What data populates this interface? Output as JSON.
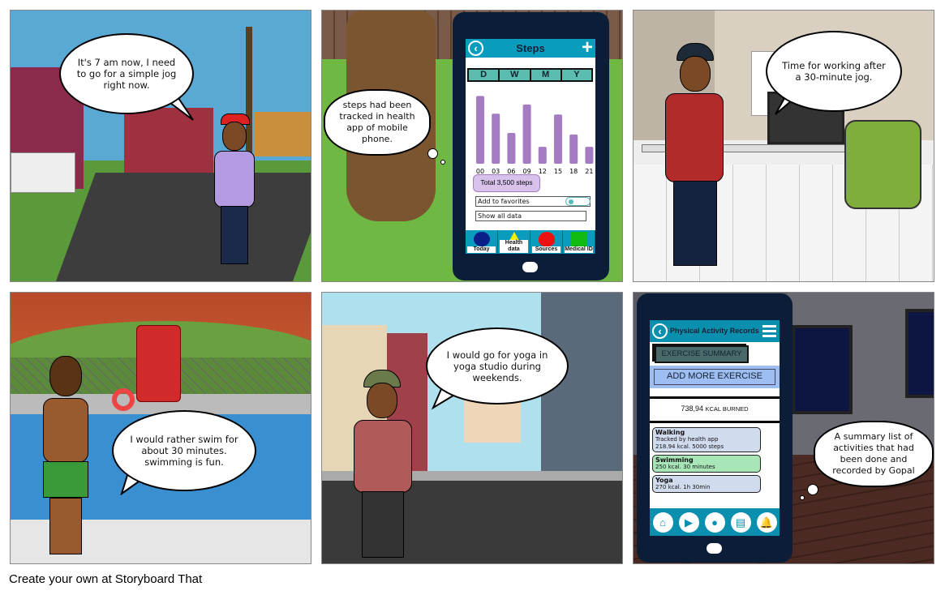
{
  "panels": {
    "p1": {
      "speech": "It's 7 am now, I need to go for a simple jog right now."
    },
    "p2": {
      "thought": "steps had been tracked in health app of mobile phone.",
      "phone": {
        "title": "Steps",
        "back_icon": "chevron-left-icon",
        "add_icon": "plus-icon",
        "range_tabs": [
          "D",
          "W",
          "M",
          "Y"
        ],
        "chart_data": {
          "type": "bar",
          "categories": [
            "00",
            "03",
            "06",
            "09",
            "12",
            "15",
            "18",
            "21"
          ],
          "values": [
            88,
            65,
            40,
            77,
            22,
            64,
            38,
            22
          ],
          "color": "#a57cc4"
        },
        "total": "Total 3,500 steps",
        "favorites_label": "Add to favorites",
        "show_all_label": "Show all data",
        "nav": [
          {
            "label": "Today",
            "icon": "circle-icon",
            "color": "#0a1f8a"
          },
          {
            "label": "Health data",
            "icon": "triangle-icon",
            "color": "#f5ef00"
          },
          {
            "label": "Sources",
            "icon": "heart-icon",
            "color": "#ee1111"
          },
          {
            "label": "Medical ID",
            "icon": "square-icon",
            "color": "#11bb11"
          }
        ]
      }
    },
    "p3": {
      "speech": "Time for working after a 30-minute jog."
    },
    "p4": {
      "speech": "I would rather swim for about 30 minutes. swimming is fun."
    },
    "p5": {
      "speech": "I would go for yoga in yoga studio during weekends."
    },
    "p6": {
      "thought": "A summary list of activities that had been done and recorded by Gopal",
      "phone": {
        "title": "Physical Activity Records",
        "summary_label": "EXERCISE SUMMARY",
        "add_label": "ADD MORE EXERCISE",
        "kcal_value": "738,94",
        "kcal_label": "KCAL BURNED",
        "activities": [
          {
            "name": "Walking",
            "lines": [
              "Tracked by health app",
              "218.94 kcal. 5000 steps"
            ],
            "color": "#d0dcee"
          },
          {
            "name": "Swimming",
            "lines": [
              "250 kcal. 30 minutes"
            ],
            "color": "#a8e6b8"
          },
          {
            "name": "Yoga",
            "lines": [
              "270 kcal.  1h 30min"
            ],
            "color": "#d0dcee"
          }
        ],
        "nav_icons": [
          "home-icon",
          "play-icon",
          "user-icon",
          "clipboard-icon",
          "bell-icon"
        ]
      }
    }
  },
  "footer": "Create your own at Storyboard That"
}
